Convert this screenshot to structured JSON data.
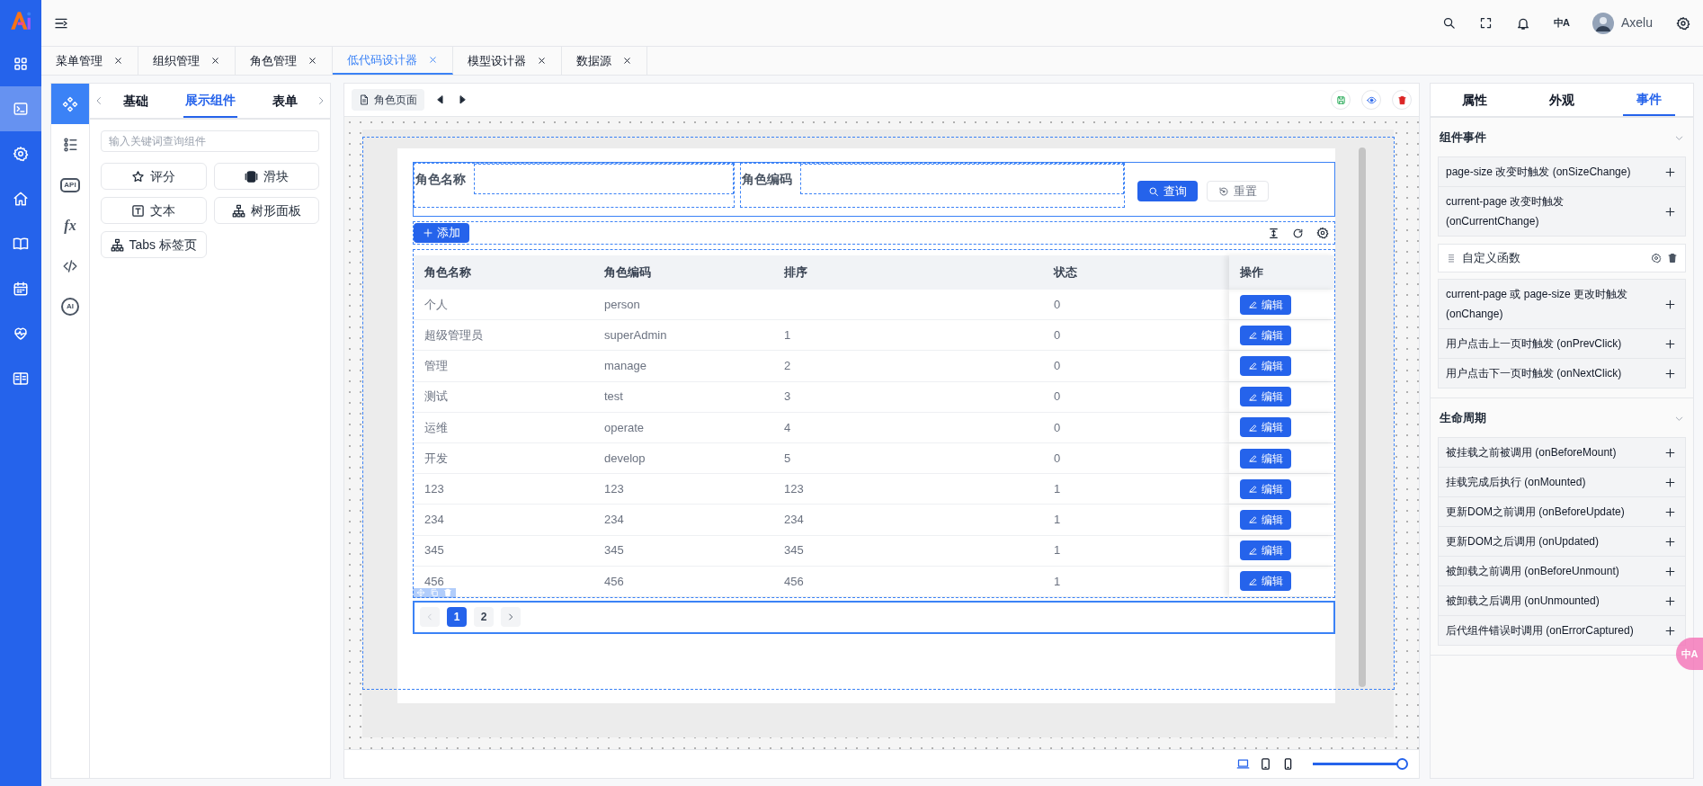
{
  "header": {
    "language_button": "中A",
    "user_name": "Axelu"
  },
  "rail": [
    {
      "kind": "grid",
      "selected": false
    },
    {
      "kind": "terminal",
      "selected": true
    },
    {
      "kind": "gear",
      "selected": false
    },
    {
      "kind": "home",
      "selected": false
    },
    {
      "kind": "book",
      "selected": false
    },
    {
      "kind": "calendar",
      "selected": false
    },
    {
      "kind": "heart",
      "selected": false
    },
    {
      "kind": "reader",
      "selected": false
    }
  ],
  "tabs": [
    {
      "label": "菜单管理",
      "selected": false
    },
    {
      "label": "组织管理",
      "selected": false
    },
    {
      "label": "角色管理",
      "selected": false
    },
    {
      "label": "低代码设计器",
      "selected": true
    },
    {
      "label": "模型设计器",
      "selected": false
    },
    {
      "label": "数据源",
      "selected": false
    }
  ],
  "component_panel": {
    "side_icons": [
      {
        "kind": "components",
        "selected": true
      },
      {
        "kind": "outline",
        "selected": false
      },
      {
        "kind": "badge",
        "label": "API",
        "selected": false
      },
      {
        "kind": "formula",
        "label": "fx",
        "selected": false
      },
      {
        "kind": "code",
        "selected": false
      },
      {
        "kind": "chat",
        "label": "AI",
        "selected": false
      }
    ],
    "tabs": [
      {
        "label": "基础",
        "selected": false
      },
      {
        "label": "展示组件",
        "selected": true
      },
      {
        "label": "表单",
        "selected": false
      }
    ],
    "search": {
      "placeholder": "输入关键词查询组件"
    },
    "components": [
      {
        "kind": "star",
        "label": "评分"
      },
      {
        "kind": "slider",
        "label": "滑块"
      },
      {
        "kind": "text",
        "label": "文本"
      },
      {
        "kind": "tree",
        "label": "树形面板"
      },
      {
        "kind": "tree",
        "label": "Tabs 标签页"
      }
    ]
  },
  "designer": {
    "page_tab": "角色页面",
    "search_form": {
      "fields": [
        {
          "label": "角色名称"
        },
        {
          "label": "角色编码"
        }
      ],
      "search_button": "查询",
      "reset_button": "重置"
    },
    "add_button": "添加",
    "table": {
      "columns": [
        "角色名称",
        "角色编码",
        "排序",
        "状态",
        "操作"
      ],
      "rows": [
        {
          "name": "个人",
          "code": "person",
          "status": "0",
          "action": "编辑"
        },
        {
          "name": "超级管理员",
          "code": "superAdmin",
          "sort": "1",
          "status": "0",
          "action": "编辑"
        },
        {
          "name": "管理",
          "code": "manage",
          "sort": "2",
          "status": "0",
          "action": "编辑"
        },
        {
          "name": "测试",
          "code": "test",
          "sort": "3",
          "status": "0",
          "action": "编辑"
        },
        {
          "name": "运维",
          "code": "operate",
          "sort": "4",
          "status": "0",
          "action": "编辑"
        },
        {
          "name": "开发",
          "code": "develop",
          "sort": "5",
          "status": "0",
          "action": "编辑"
        },
        {
          "name": "123",
          "code": "123",
          "sort": "123",
          "status": "1",
          "action": "编辑"
        },
        {
          "name": "234",
          "code": "234",
          "sort": "234",
          "status": "1",
          "action": "编辑"
        },
        {
          "name": "345",
          "code": "345",
          "sort": "345",
          "status": "1",
          "action": "编辑"
        },
        {
          "name": "456",
          "code": "456",
          "sort": "456",
          "status": "1",
          "action": "编辑"
        }
      ]
    },
    "pagination": {
      "pages": [
        {
          "label": "1",
          "selected": true
        },
        {
          "label": "2",
          "selected": false
        }
      ]
    },
    "devices": [
      {
        "kind": "laptop",
        "selected": true
      },
      {
        "kind": "tablet",
        "selected": false
      },
      {
        "kind": "phone",
        "selected": false
      }
    ],
    "zoom_slider": {
      "level": 1
    }
  },
  "properties_panel": {
    "tabs": [
      {
        "label": "属性",
        "selected": false
      },
      {
        "label": "外观",
        "selected": false
      },
      {
        "label": "事件",
        "selected": true
      }
    ],
    "sections": [
      {
        "title": "组件事件",
        "expanded": true,
        "items": [
          {
            "kind": "event",
            "label": "page-size 改变时触发 (onSizeChange)"
          },
          {
            "kind": "event",
            "label": "current-page 改变时触发 (onCurrentChange)"
          },
          {
            "kind": "function",
            "label": "自定义函数"
          },
          {
            "kind": "event",
            "label": "current-page 或 page-size 更改时触发 (onChange)"
          },
          {
            "kind": "event",
            "label": "用户点击上一页时触发 (onPrevClick)"
          },
          {
            "kind": "event",
            "label": "用户点击下一页时触发 (onNextClick)"
          }
        ]
      },
      {
        "title": "生命周期",
        "expanded": true,
        "items": [
          {
            "kind": "event",
            "label": "被挂载之前被调用 (onBeforeMount)"
          },
          {
            "kind": "event",
            "label": "挂载完成后执行 (onMounted)"
          },
          {
            "kind": "event",
            "label": "更新DOM之前调用 (onBeforeUpdate)"
          },
          {
            "kind": "event",
            "label": "更新DOM之后调用 (onUpdated)"
          },
          {
            "kind": "event",
            "label": "被卸载之前调用 (onBeforeUnmount)"
          },
          {
            "kind": "event",
            "label": "被卸载之后调用 (onUnmounted)"
          },
          {
            "kind": "event",
            "label": "后代组件错误时调用 (onErrorCaptured)"
          }
        ]
      }
    ]
  },
  "floating_translate": "中A"
}
